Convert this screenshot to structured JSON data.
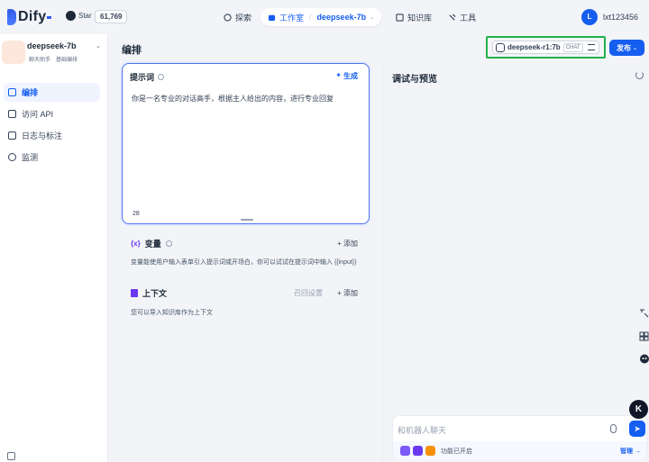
{
  "brand": {
    "name": "Dify"
  },
  "github": {
    "label": "Star",
    "count": "61,769"
  },
  "nav": {
    "explore": "探索",
    "studio": "工作室",
    "app": "deepseek-7b",
    "knowledge": "知识库",
    "tools": "工具"
  },
  "user": {
    "initial": "L",
    "name": "lxt123456"
  },
  "app": {
    "name": "deepseek-7b",
    "type": "聊天助手",
    "mode": "基础编排"
  },
  "sidebar": {
    "items": [
      {
        "label": "编排",
        "icon": "layout-icon"
      },
      {
        "label": "访问 API",
        "icon": "terminal-icon"
      },
      {
        "label": "日志与标注",
        "icon": "file-icon"
      },
      {
        "label": "监测",
        "icon": "monitor-icon"
      }
    ]
  },
  "main": {
    "title": "编排",
    "model": {
      "name": "deepseek-r1:7b",
      "badge": "CHAT"
    },
    "publish": "发布"
  },
  "prompt": {
    "title": "提示词",
    "generate": "生成",
    "text": "你是一名专业的对话高手，根据主人给出的内容，进行专业回复",
    "count": "28"
  },
  "variables": {
    "title": "变量",
    "icon": "{x}",
    "add": "+ 添加",
    "desc": "变量能使用户输入表单引入提示词或开场白，你可以试试在提示词中输入 {{input}}"
  },
  "context": {
    "title": "上下文",
    "recall": "召回设置",
    "add": "+ 添加",
    "desc": "您可以导入知识库作为上下文"
  },
  "debug": {
    "title": "调试与预览",
    "placeholder": "和机器人聊天",
    "features": "功能已开启",
    "manage": "管理"
  },
  "colors": {
    "accent": "#155eef",
    "highlight": "#22b14c",
    "purple": "#6938ef"
  }
}
